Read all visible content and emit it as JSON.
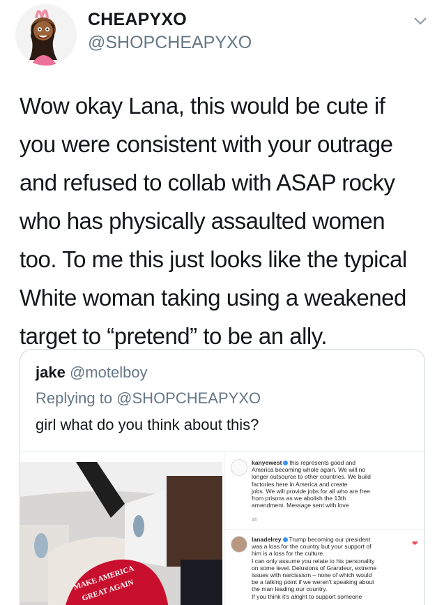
{
  "tweet": {
    "display_name": "CHEAPYXO",
    "handle": "@SHOPCHEAPYXO",
    "lines": [
      "Wow okay Lana, this would be cute if",
      "you were consistent with your outrage",
      "and refused to collab with ASAP rocky",
      "who has physically assaulted women",
      "too. To me this just looks like the typical",
      "White woman taking using a weakened",
      "target to “pretend” to be an ally."
    ],
    "avatar_icon": "cartoon-avatar-icon",
    "menu_icon": "chevron-down-icon"
  },
  "quote": {
    "name": "jake",
    "handle": "@motelboy",
    "replying_to": "Replying to @SHOPCHEAPYXO",
    "text": "girl what do you think about this?"
  },
  "media": {
    "hat_text_line1": "MAKE AMERICA",
    "hat_text_line2": "GREAT AGAIN",
    "comments": [
      {
        "user": "kanyewest",
        "lines": [
          "this represents good and",
          "America becoming whole again.  We will no",
          "longer outsource to other countries. We build",
          "factories here in America and create",
          "jobs.  We will provide jobs for all who are free",
          "from prisons as we abolish the 13th",
          "amendment. Message sent with love"
        ],
        "time": "4h"
      },
      {
        "user": "lanadelrey",
        "lines": [
          "Trump becoming our president",
          "was a loss for the country but your support of",
          "him is a loss for the culture.",
          "I can only assume you relate to his personality",
          "on some level. Delusions of Grandeur, extreme",
          "issues with narcissism – none of which would",
          "be a talking point if we weren't speaking about",
          "the man leading our country.",
          "If you think it's alright to support someone"
        ]
      }
    ],
    "colors": {
      "hat_red": "#c8102e",
      "verified_blue": "#3897f0",
      "heart_red": "#ed4956"
    }
  }
}
